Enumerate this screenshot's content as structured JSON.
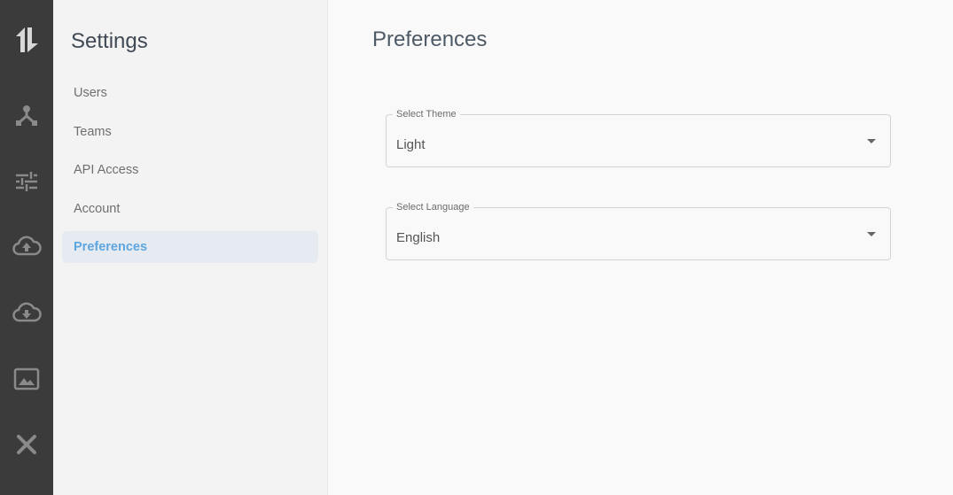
{
  "iconbar": {
    "items": [
      {
        "icon": "logo-icon"
      },
      {
        "icon": "network-icon"
      },
      {
        "icon": "sliders-icon"
      },
      {
        "icon": "cloud-upload-icon"
      },
      {
        "icon": "cloud-download-icon"
      },
      {
        "icon": "image-icon"
      },
      {
        "icon": "tools-icon"
      }
    ],
    "color": "#8a8a8a"
  },
  "sidebar": {
    "title": "Settings",
    "items": [
      {
        "label": "Users"
      },
      {
        "label": "Teams"
      },
      {
        "label": "API Access"
      },
      {
        "label": "Account"
      },
      {
        "label": "Preferences",
        "active": true
      }
    ]
  },
  "main": {
    "title": "Preferences",
    "theme": {
      "label": "Select Theme",
      "value": "Light"
    },
    "language": {
      "label": "Select Language",
      "value": "English"
    }
  },
  "colors": {
    "accent": "#5ea6e0",
    "iconbar_bg": "#3b3b3b"
  }
}
